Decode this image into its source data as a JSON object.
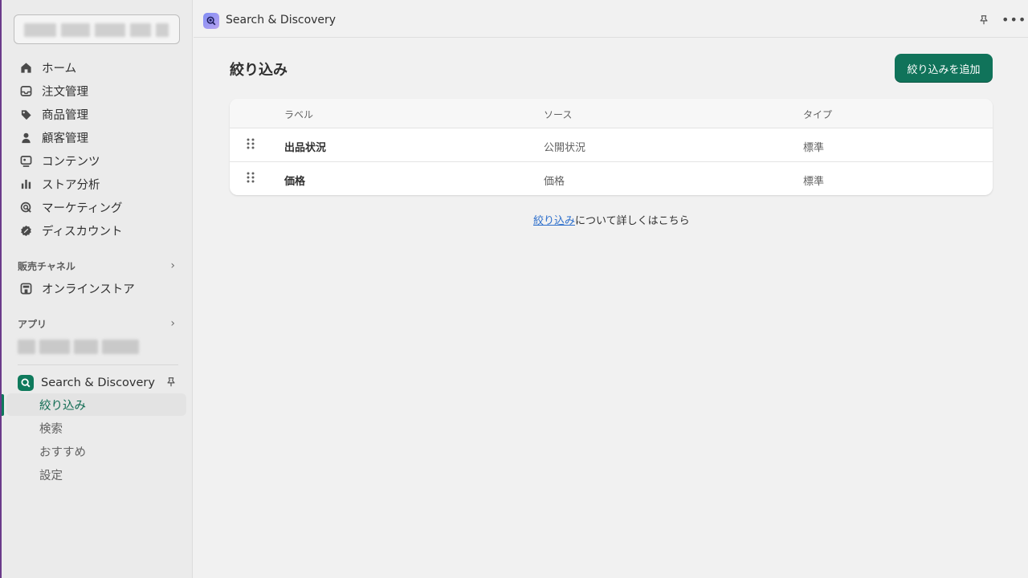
{
  "sidebar": {
    "nav": [
      {
        "label": "ホーム",
        "icon": "home-icon"
      },
      {
        "label": "注文管理",
        "icon": "inbox-icon"
      },
      {
        "label": "商品管理",
        "icon": "tag-icon"
      },
      {
        "label": "顧客管理",
        "icon": "person-icon"
      },
      {
        "label": "コンテンツ",
        "icon": "content-icon"
      },
      {
        "label": "ストア分析",
        "icon": "bar-chart-icon"
      },
      {
        "label": "マーケティング",
        "icon": "target-icon"
      },
      {
        "label": "ディスカウント",
        "icon": "discount-icon"
      }
    ],
    "sales_channels": {
      "label": "販売チャネル",
      "items": [
        {
          "label": "オンラインストア",
          "icon": "store-icon"
        }
      ]
    },
    "apps": {
      "label": "アプリ"
    },
    "app": {
      "label": "Search & Discovery",
      "subitems": [
        {
          "label": "絞り込み",
          "active": true
        },
        {
          "label": "検索"
        },
        {
          "label": "おすすめ"
        },
        {
          "label": "設定"
        }
      ]
    }
  },
  "topbar": {
    "title": "Search & Discovery"
  },
  "main": {
    "title": "絞り込み",
    "add_button": "絞り込みを追加",
    "table": {
      "columns": [
        "ラベル",
        "ソース",
        "タイプ"
      ],
      "rows": [
        {
          "label": "出品状況",
          "source": "公開状況",
          "type": "標準"
        },
        {
          "label": "価格",
          "source": "価格",
          "type": "標準"
        }
      ]
    },
    "learn_more": {
      "link": "絞り込み",
      "text": "について詳しくはこちら"
    }
  },
  "colors": {
    "primary": "#10735a",
    "link": "#2c6ecb",
    "accent": "#6b3a8a"
  }
}
